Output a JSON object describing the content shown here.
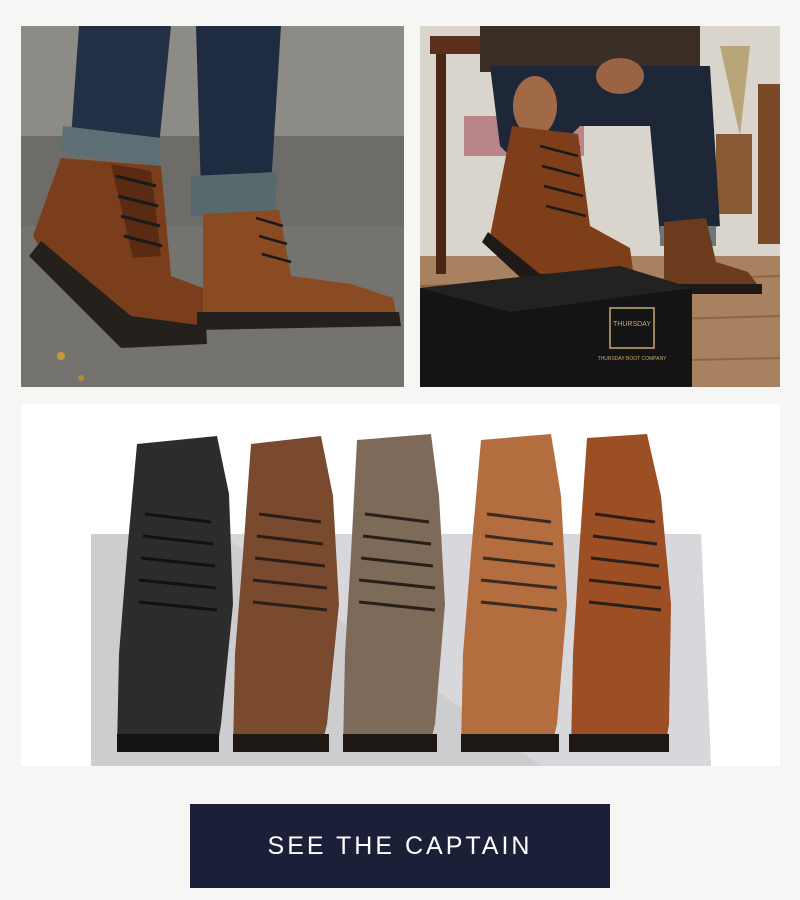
{
  "cta": {
    "label": "SEE THE CAPTAIN"
  },
  "box_logo": {
    "brand": "THURSDAY",
    "tagline": "THURSDAY BOOT COMPANY"
  },
  "colors": {
    "cta_background": "#1b2038",
    "cta_text": "#ffffff",
    "page_background": "#f6f6f4"
  }
}
